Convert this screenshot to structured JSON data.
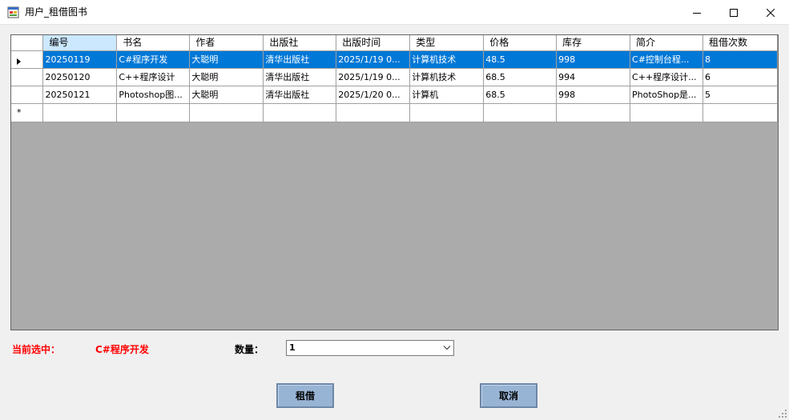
{
  "window": {
    "title": "用户_租借图书",
    "icon": "form-icon"
  },
  "grid": {
    "columns": [
      "编号",
      "书名",
      "作者",
      "出版社",
      "出版时间",
      "类型",
      "价格",
      "库存",
      "简介",
      "租借次数"
    ],
    "rows": [
      [
        "20250119",
        "C#程序开发",
        "大聪明",
        "清华出版社",
        "2025/1/19 0...",
        "计算机技术",
        "48.5",
        "998",
        "C#控制台程...",
        "8"
      ],
      [
        "20250120",
        "C++程序设计",
        "大聪明",
        "清华出版社",
        "2025/1/19 0...",
        "计算机技术",
        "68.5",
        "994",
        "C++程序设计...",
        "6"
      ],
      [
        "20250121",
        "Photoshop图...",
        "大聪明",
        "清华出版社",
        "2025/1/20 0...",
        "计算机",
        "68.5",
        "998",
        "PhotoShop是...",
        "5"
      ]
    ],
    "selected_row": 0,
    "new_row_marker": "*",
    "selection_color": "#0078d7"
  },
  "form": {
    "current_label": "当前选中：",
    "current_value": "C#程序开发",
    "quantity_label": "数量：",
    "quantity_value": "1",
    "rent_button": "租借",
    "cancel_button": "取消",
    "accent_color": "#ff0000"
  }
}
